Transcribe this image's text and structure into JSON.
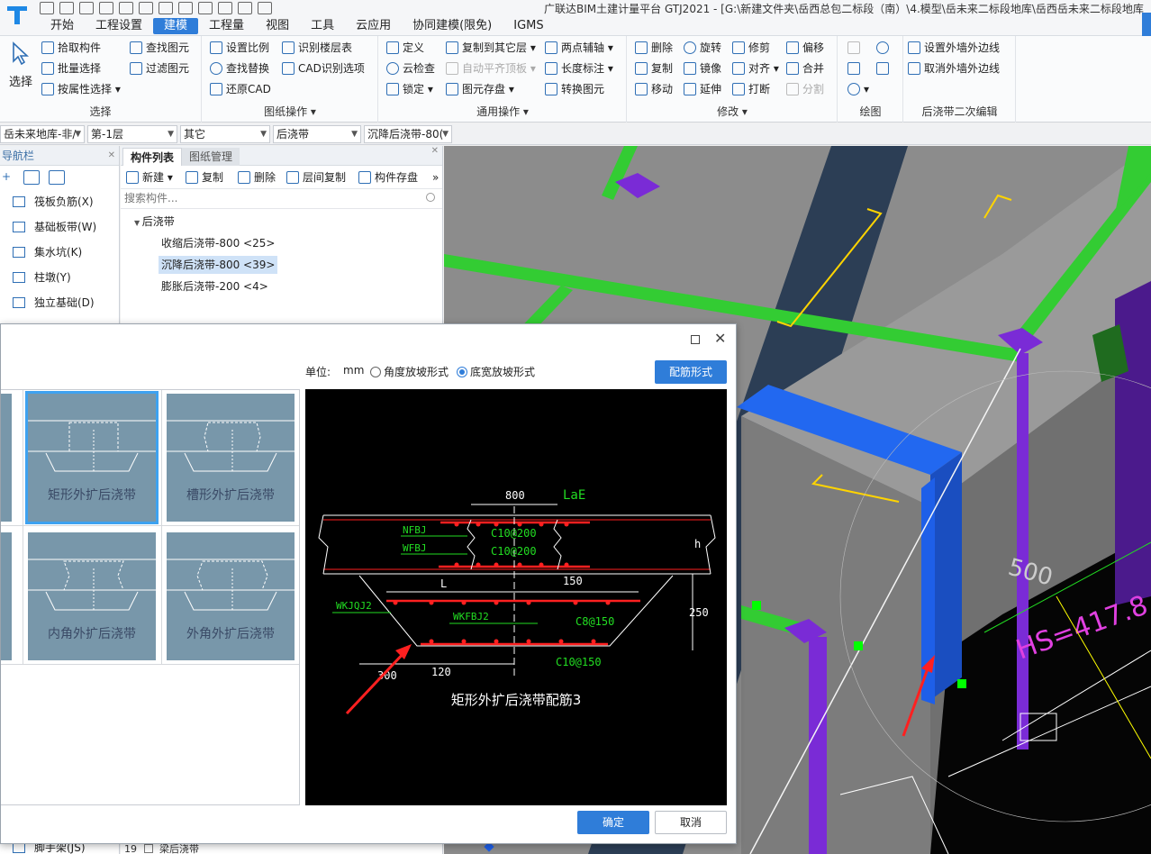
{
  "app": {
    "title": "广联达BIM土建计量平台 GTJ2021 - [G:\\新建文件夹\\岳西总包二标段（南）\\4.模型\\岳未来二标段地库\\岳西岳未来二标段地库"
  },
  "menu": {
    "tabs": [
      "开始",
      "工程设置",
      "建模",
      "工程量",
      "视图",
      "工具",
      "云应用",
      "协同建模(限免)",
      "IGMS"
    ],
    "active_index": 2
  },
  "ribbon": {
    "select_group": {
      "big_button": "选择",
      "items": [
        "拾取构件",
        "批量选择",
        "按属性选择",
        "查找图元",
        "过滤图元"
      ],
      "title": "选择"
    },
    "drawing_group": {
      "items": [
        "设置比例",
        "查找替换",
        "还原CAD",
        "识别楼层表",
        "CAD识别选项"
      ],
      "title": "图纸操作"
    },
    "common_group": {
      "items": [
        "定义",
        "云检查",
        "锁定",
        "复制到其它层",
        "自动平齐顶板",
        "图元存盘",
        "两点辅轴",
        "长度标注",
        "转换图元"
      ],
      "title": "通用操作"
    },
    "modify_group": {
      "items": [
        "删除",
        "旋转",
        "修剪",
        "偏移",
        "复制",
        "镜像",
        "对齐",
        "合并",
        "移动",
        "延伸",
        "打断",
        "分割"
      ],
      "title": "修改"
    },
    "draw_group": {
      "title": "绘图"
    },
    "edit2_group": {
      "items": [
        "设置外墙外边线",
        "取消外墙外边线"
      ],
      "title": "后浇带二次编辑"
    }
  },
  "combos": [
    "岳未来地库-非/",
    "第-1层",
    "其它",
    "后浇带",
    "沉降后浇带-80("
  ],
  "nav": {
    "title": "导航栏",
    "items": [
      "筏板负筋(X)",
      "基础板带(W)",
      "集水坑(K)",
      "柱墩(Y)",
      "独立基础(D)"
    ],
    "bottom_item": "脚手架(JS)"
  },
  "component_panel": {
    "tabs": [
      "构件列表",
      "图纸管理"
    ],
    "tools": [
      "新建",
      "复制",
      "删除",
      "层间复制",
      "构件存盘"
    ],
    "search_placeholder": "搜索构件...",
    "tree_root": "后浇带",
    "tree_items": [
      "收缩后浇带-800 <25>",
      "沉降后浇带-800 <39>",
      "膨胀后浇带-200 <4>"
    ],
    "selected_index": 1,
    "bottom_row_index": "19",
    "bottom_row_label": "梁后浇带"
  },
  "dialog": {
    "unit_label": "单位:",
    "unit_value": "mm",
    "radio_angle": "角度放坡形式",
    "radio_width": "底宽放坡形式",
    "selected_radio": "radio_width",
    "rebar_button": "配筋形式",
    "cards": [
      "矩形外扩后浇带",
      "槽形外扩后浇带",
      "内角外扩后浇带",
      "外角外扩后浇带"
    ],
    "selected_card_index": 0,
    "ok": "确定",
    "cancel": "取消",
    "preview": {
      "dim_top": "800",
      "lae": "LaE",
      "nfbj": "NFBJ",
      "wfbj": "WFBJ",
      "c10_1": "C10@200",
      "c10_2": "C10@200",
      "h": "h",
      "l": "L",
      "dim_150": "150",
      "wkjqj2": "WKJQJ2",
      "wkfbj2": "WKFBJ2",
      "c8": "C8@150",
      "dim_250": "250",
      "c10_3": "C10@150",
      "dim_300": "300",
      "dim_120": "120",
      "caption": "矩形外扩后浇带配筋3"
    }
  },
  "viewport": {
    "label_500": "500",
    "label_hs": "HS=417.8"
  },
  "colors": {
    "accent": "#2f7dd9",
    "green_beam": "#33cc33",
    "purple": "#7a2bd6",
    "blue_wall": "#1e5fe8",
    "dark_band": "#2c3e55",
    "cad_red": "#ff2020",
    "cad_green": "#22dd22"
  }
}
